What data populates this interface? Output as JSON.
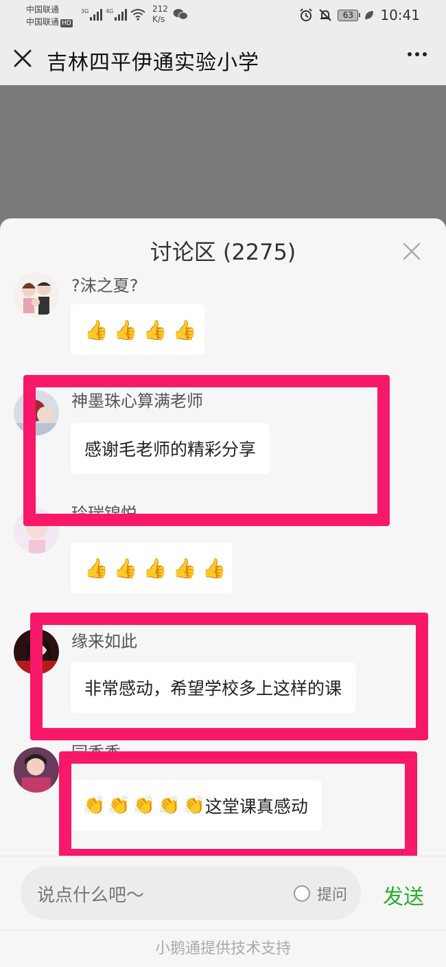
{
  "status_bar": {
    "carrier1": "中国联通",
    "carrier2": "中国联通",
    "hd": "HD",
    "net1": "3G",
    "net2": "4G",
    "speed_value": "212",
    "speed_unit": "K/s",
    "battery": "63",
    "time": "10:41"
  },
  "header": {
    "title": "吉林四平伊通实验小学",
    "close_icon": "close-icon",
    "more_icon": "more-icon"
  },
  "discussion": {
    "title": "讨论区 (2275)",
    "comments": [
      {
        "user": "?沫之夏?",
        "text": "",
        "emoji": "thumbs-up",
        "emoji_count": 4
      },
      {
        "user": "神墨珠心算满老师",
        "text": "感谢毛老师的精彩分享"
      },
      {
        "user": "玲瑞锦悦",
        "text": "",
        "emoji": "thumbs-up",
        "emoji_count": 5
      },
      {
        "user": "缘来如此",
        "text": "非常感动，希望学校多上这样的课"
      },
      {
        "user": "园香香",
        "text": "这堂课真感动",
        "emoji": "clapping-hands",
        "emoji_count": 5
      }
    ]
  },
  "input": {
    "placeholder": "说点什么吧～",
    "ask_label": "提问",
    "send_label": "发送"
  },
  "footer": {
    "text": "小鹅通提供技术支持"
  },
  "colors": {
    "accent_green": "#2aae2e",
    "highlight": "#f8186a"
  }
}
